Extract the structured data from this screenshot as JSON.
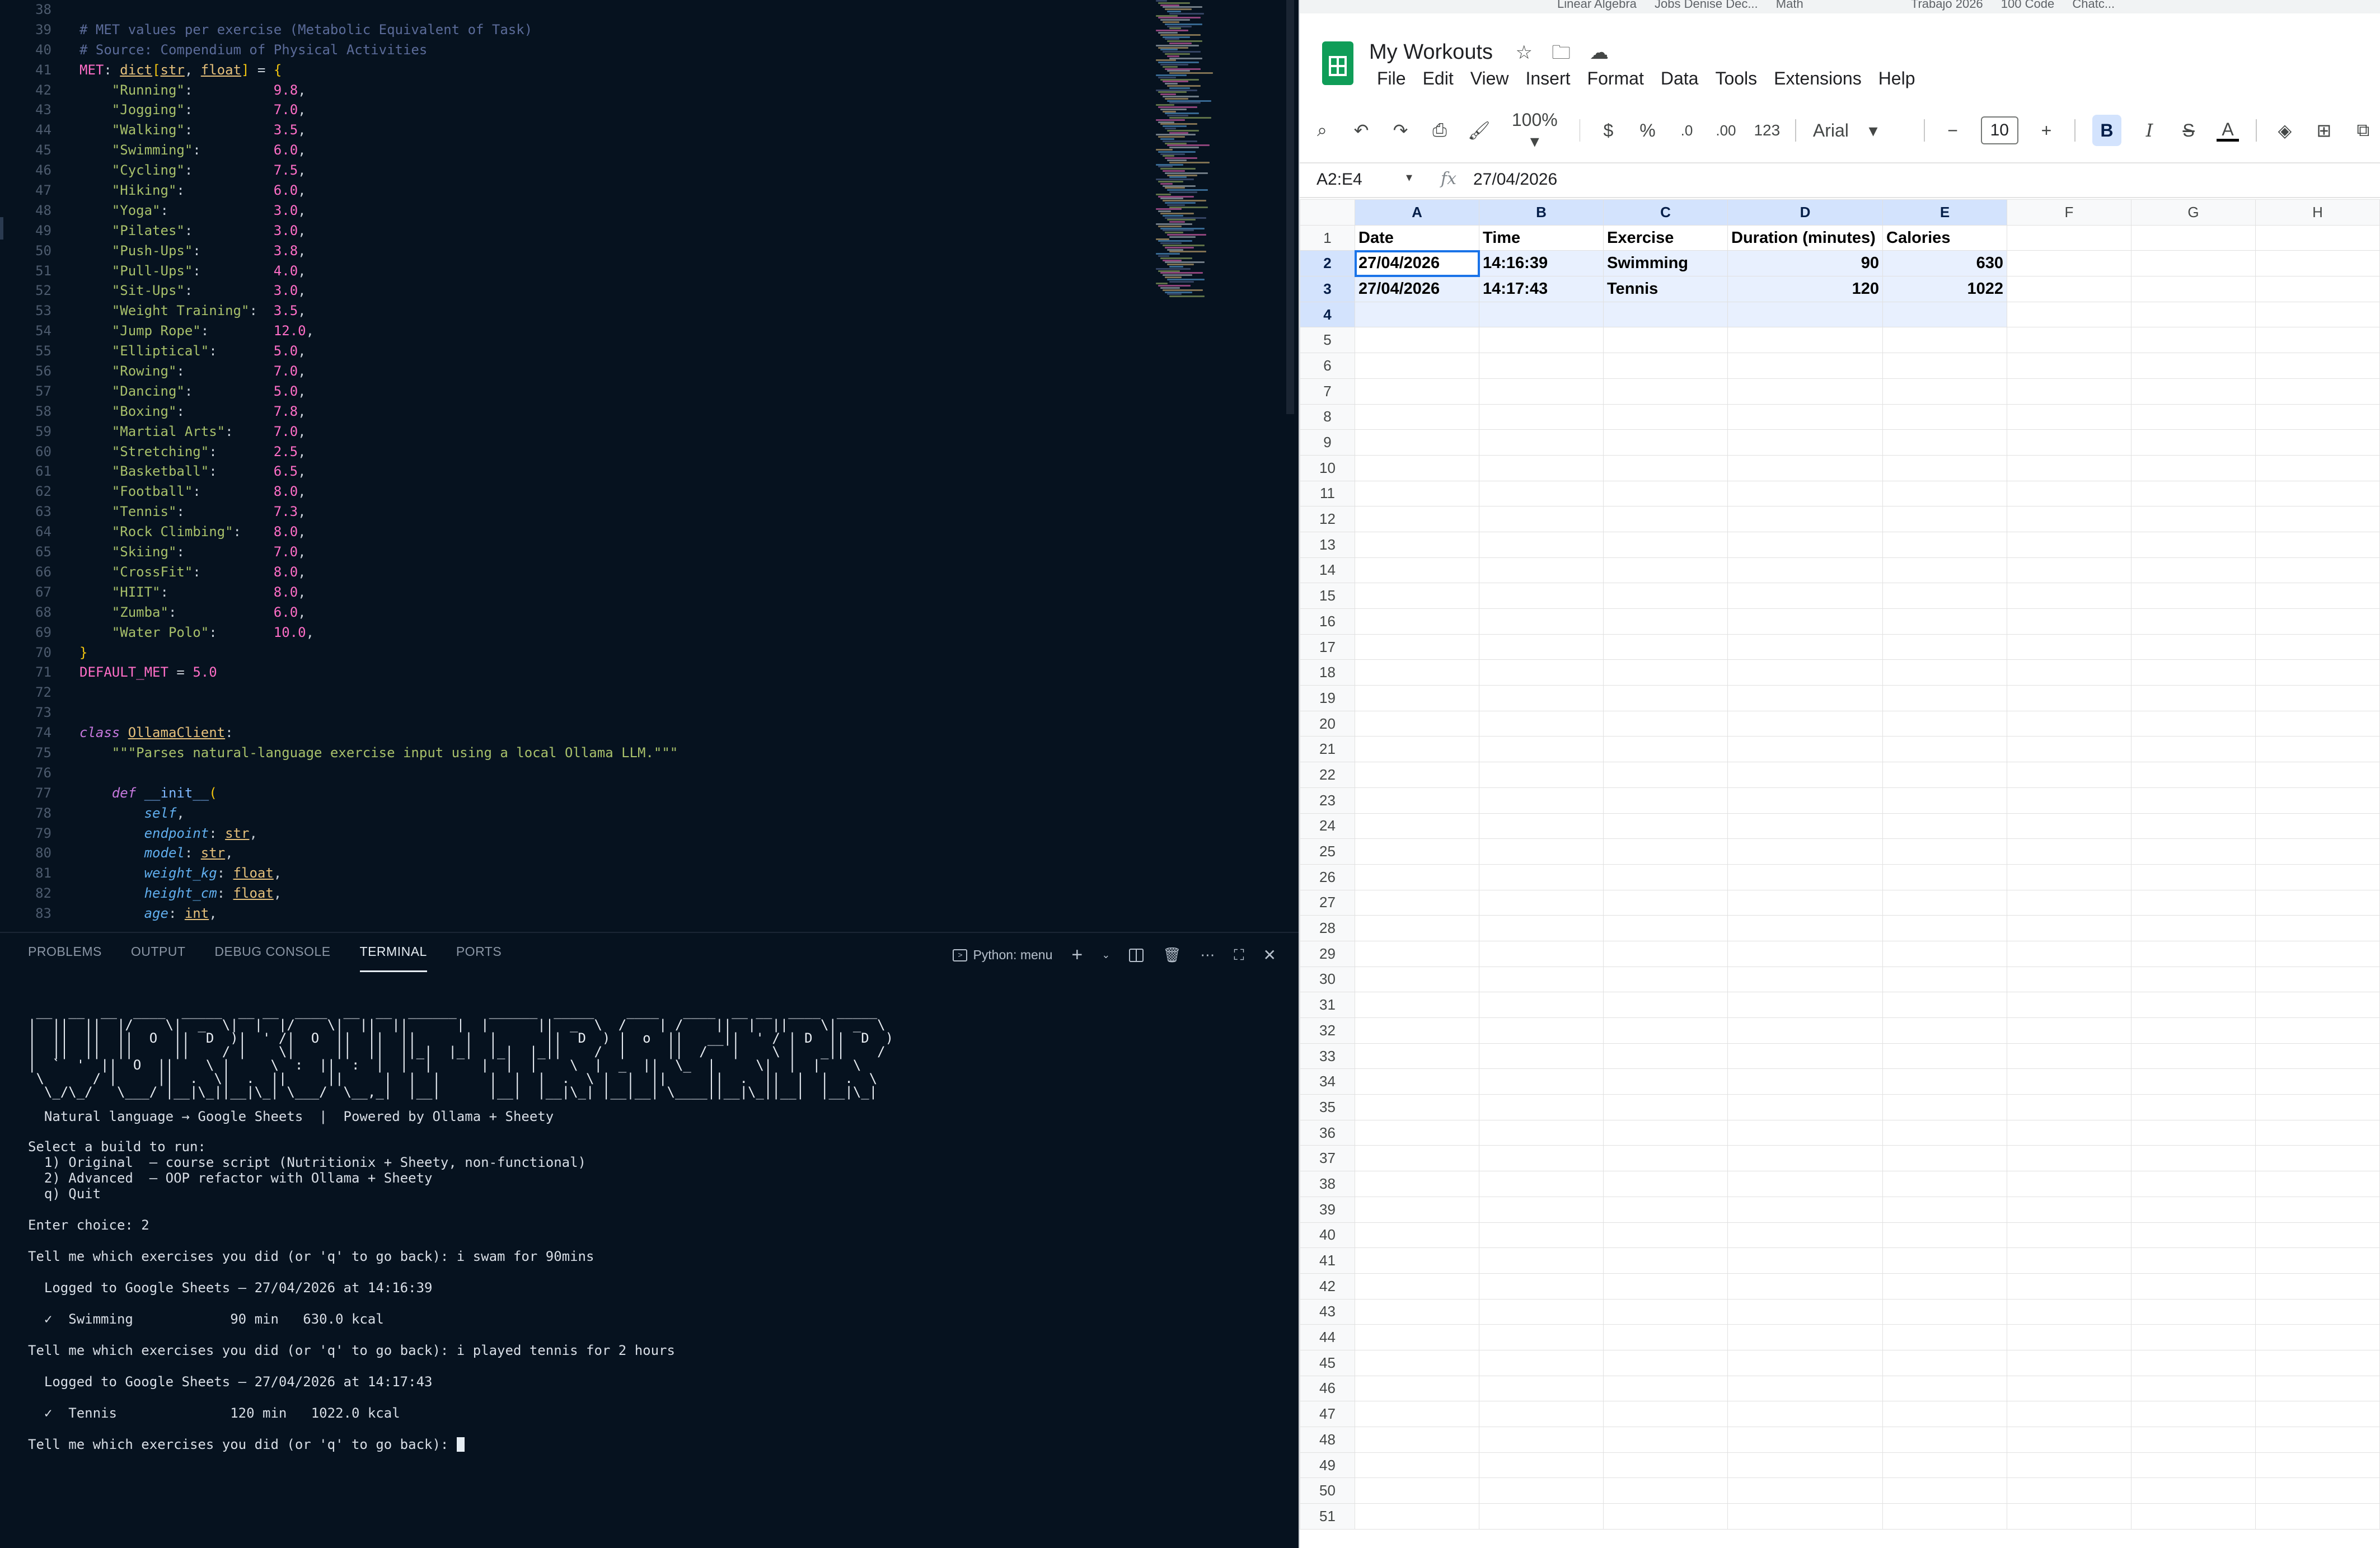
{
  "editor": {
    "lines": [
      {
        "n": "38",
        "parts": []
      },
      {
        "n": "39",
        "parts": [
          [
            "c-cm",
            "# MET values per exercise (Metabolic Equivalent of Task)"
          ]
        ]
      },
      {
        "n": "40",
        "parts": [
          [
            "c-cm",
            "# Source: Compendium of Physical Activities"
          ]
        ]
      },
      {
        "n": "41",
        "parts": [
          [
            "c-var",
            "MET"
          ],
          [
            "",
            ": "
          ],
          [
            "c-ty",
            "dict"
          ],
          [
            "c-brk",
            "["
          ],
          [
            "c-ty",
            "str"
          ],
          [
            "",
            ", "
          ],
          [
            "c-ty",
            "float"
          ],
          [
            "c-brk",
            "]"
          ],
          [
            "",
            " = "
          ],
          [
            "c-brk",
            "{"
          ]
        ]
      },
      {
        "n": "42",
        "parts": [
          [
            "",
            "    "
          ],
          [
            "c-str",
            "\"Running\""
          ],
          [
            "",
            ":          "
          ],
          [
            "c-num",
            "9.8"
          ],
          [
            "",
            ","
          ]
        ]
      },
      {
        "n": "43",
        "parts": [
          [
            "",
            "    "
          ],
          [
            "c-str",
            "\"Jogging\""
          ],
          [
            "",
            ":          "
          ],
          [
            "c-num",
            "7.0"
          ],
          [
            "",
            ","
          ]
        ]
      },
      {
        "n": "44",
        "parts": [
          [
            "",
            "    "
          ],
          [
            "c-str",
            "\"Walking\""
          ],
          [
            "",
            ":          "
          ],
          [
            "c-num",
            "3.5"
          ],
          [
            "",
            ","
          ]
        ]
      },
      {
        "n": "45",
        "parts": [
          [
            "",
            "    "
          ],
          [
            "c-str",
            "\"Swimming\""
          ],
          [
            "",
            ":         "
          ],
          [
            "c-num",
            "6.0"
          ],
          [
            "",
            ","
          ]
        ]
      },
      {
        "n": "46",
        "parts": [
          [
            "",
            "    "
          ],
          [
            "c-str",
            "\"Cycling\""
          ],
          [
            "",
            ":          "
          ],
          [
            "c-num",
            "7.5"
          ],
          [
            "",
            ","
          ]
        ]
      },
      {
        "n": "47",
        "parts": [
          [
            "",
            "    "
          ],
          [
            "c-str",
            "\"Hiking\""
          ],
          [
            "",
            ":           "
          ],
          [
            "c-num",
            "6.0"
          ],
          [
            "",
            ","
          ]
        ]
      },
      {
        "n": "48",
        "parts": [
          [
            "",
            "    "
          ],
          [
            "c-str",
            "\"Yoga\""
          ],
          [
            "",
            ":             "
          ],
          [
            "c-num",
            "3.0"
          ],
          [
            "",
            ","
          ]
        ]
      },
      {
        "n": "49",
        "parts": [
          [
            "",
            "    "
          ],
          [
            "c-str",
            "\"Pilates\""
          ],
          [
            "",
            ":          "
          ],
          [
            "c-num",
            "3.0"
          ],
          [
            "",
            ","
          ]
        ]
      },
      {
        "n": "50",
        "parts": [
          [
            "",
            "    "
          ],
          [
            "c-str",
            "\"Push-Ups\""
          ],
          [
            "",
            ":         "
          ],
          [
            "c-num",
            "3.8"
          ],
          [
            "",
            ","
          ]
        ]
      },
      {
        "n": "51",
        "parts": [
          [
            "",
            "    "
          ],
          [
            "c-str",
            "\"Pull-Ups\""
          ],
          [
            "",
            ":         "
          ],
          [
            "c-num",
            "4.0"
          ],
          [
            "",
            ","
          ]
        ]
      },
      {
        "n": "52",
        "parts": [
          [
            "",
            "    "
          ],
          [
            "c-str",
            "\"Sit-Ups\""
          ],
          [
            "",
            ":          "
          ],
          [
            "c-num",
            "3.0"
          ],
          [
            "",
            ","
          ]
        ]
      },
      {
        "n": "53",
        "parts": [
          [
            "",
            "    "
          ],
          [
            "c-str",
            "\"Weight Training\""
          ],
          [
            "",
            ":  "
          ],
          [
            "c-num",
            "3.5"
          ],
          [
            "",
            ","
          ]
        ]
      },
      {
        "n": "54",
        "parts": [
          [
            "",
            "    "
          ],
          [
            "c-str",
            "\"Jump Rope\""
          ],
          [
            "",
            ":        "
          ],
          [
            "c-num",
            "12.0"
          ],
          [
            "",
            ","
          ]
        ]
      },
      {
        "n": "55",
        "parts": [
          [
            "",
            "    "
          ],
          [
            "c-str",
            "\"Elliptical\""
          ],
          [
            "",
            ":       "
          ],
          [
            "c-num",
            "5.0"
          ],
          [
            "",
            ","
          ]
        ]
      },
      {
        "n": "56",
        "parts": [
          [
            "",
            "    "
          ],
          [
            "c-str",
            "\"Rowing\""
          ],
          [
            "",
            ":           "
          ],
          [
            "c-num",
            "7.0"
          ],
          [
            "",
            ","
          ]
        ]
      },
      {
        "n": "57",
        "parts": [
          [
            "",
            "    "
          ],
          [
            "c-str",
            "\"Dancing\""
          ],
          [
            "",
            ":          "
          ],
          [
            "c-num",
            "5.0"
          ],
          [
            "",
            ","
          ]
        ]
      },
      {
        "n": "58",
        "parts": [
          [
            "",
            "    "
          ],
          [
            "c-str",
            "\"Boxing\""
          ],
          [
            "",
            ":           "
          ],
          [
            "c-num",
            "7.8"
          ],
          [
            "",
            ","
          ]
        ]
      },
      {
        "n": "59",
        "parts": [
          [
            "",
            "    "
          ],
          [
            "c-str",
            "\"Martial Arts\""
          ],
          [
            "",
            ":     "
          ],
          [
            "c-num",
            "7.0"
          ],
          [
            "",
            ","
          ]
        ]
      },
      {
        "n": "60",
        "parts": [
          [
            "",
            "    "
          ],
          [
            "c-str",
            "\"Stretching\""
          ],
          [
            "",
            ":       "
          ],
          [
            "c-num",
            "2.5"
          ],
          [
            "",
            ","
          ]
        ]
      },
      {
        "n": "61",
        "parts": [
          [
            "",
            "    "
          ],
          [
            "c-str",
            "\"Basketball\""
          ],
          [
            "",
            ":       "
          ],
          [
            "c-num",
            "6.5"
          ],
          [
            "",
            ","
          ]
        ]
      },
      {
        "n": "62",
        "parts": [
          [
            "",
            "    "
          ],
          [
            "c-str",
            "\"Football\""
          ],
          [
            "",
            ":         "
          ],
          [
            "c-num",
            "8.0"
          ],
          [
            "",
            ","
          ]
        ]
      },
      {
        "n": "63",
        "parts": [
          [
            "",
            "    "
          ],
          [
            "c-str",
            "\"Tennis\""
          ],
          [
            "",
            ":           "
          ],
          [
            "c-num",
            "7.3"
          ],
          [
            "",
            ","
          ]
        ]
      },
      {
        "n": "64",
        "parts": [
          [
            "",
            "    "
          ],
          [
            "c-str",
            "\"Rock Climbing\""
          ],
          [
            "",
            ":    "
          ],
          [
            "c-num",
            "8.0"
          ],
          [
            "",
            ","
          ]
        ]
      },
      {
        "n": "65",
        "parts": [
          [
            "",
            "    "
          ],
          [
            "c-str",
            "\"Skiing\""
          ],
          [
            "",
            ":           "
          ],
          [
            "c-num",
            "7.0"
          ],
          [
            "",
            ","
          ]
        ]
      },
      {
        "n": "66",
        "parts": [
          [
            "",
            "    "
          ],
          [
            "c-str",
            "\"CrossFit\""
          ],
          [
            "",
            ":         "
          ],
          [
            "c-num",
            "8.0"
          ],
          [
            "",
            ","
          ]
        ]
      },
      {
        "n": "67",
        "parts": [
          [
            "",
            "    "
          ],
          [
            "c-str",
            "\"HIIT\""
          ],
          [
            "",
            ":             "
          ],
          [
            "c-num",
            "8.0"
          ],
          [
            "",
            ","
          ]
        ]
      },
      {
        "n": "68",
        "parts": [
          [
            "",
            "    "
          ],
          [
            "c-str",
            "\"Zumba\""
          ],
          [
            "",
            ":            "
          ],
          [
            "c-num",
            "6.0"
          ],
          [
            "",
            ","
          ]
        ]
      },
      {
        "n": "69",
        "parts": [
          [
            "",
            "    "
          ],
          [
            "c-str",
            "\"Water Polo\""
          ],
          [
            "",
            ":       "
          ],
          [
            "c-num",
            "10.0"
          ],
          [
            "",
            ","
          ]
        ]
      },
      {
        "n": "70",
        "parts": [
          [
            "c-brk",
            "}"
          ]
        ]
      },
      {
        "n": "71",
        "parts": [
          [
            "c-var",
            "DEFAULT_MET"
          ],
          [
            "",
            " = "
          ],
          [
            "c-num",
            "5.0"
          ]
        ]
      },
      {
        "n": "72",
        "parts": []
      },
      {
        "n": "73",
        "parts": []
      },
      {
        "n": "74",
        "parts": [
          [
            "c-kw",
            "class"
          ],
          [
            "",
            " "
          ],
          [
            "c-cls",
            "OllamaClient"
          ],
          [
            "",
            ":"
          ]
        ]
      },
      {
        "n": "75",
        "parts": [
          [
            "",
            "    "
          ],
          [
            "c-doc",
            "\"\"\"Parses natural-language exercise input using a local Ollama LLM.\"\"\""
          ]
        ]
      },
      {
        "n": "76",
        "parts": []
      },
      {
        "n": "77",
        "parts": [
          [
            "",
            "    "
          ],
          [
            "c-kw",
            "def"
          ],
          [
            "",
            " "
          ],
          [
            "c-fn",
            "__init__"
          ],
          [
            "c-brk",
            "("
          ]
        ]
      },
      {
        "n": "78",
        "parts": [
          [
            "",
            "        "
          ],
          [
            "c-par",
            "self"
          ],
          [
            "",
            ","
          ]
        ]
      },
      {
        "n": "79",
        "parts": [
          [
            "",
            "        "
          ],
          [
            "c-par",
            "endpoint"
          ],
          [
            "",
            ": "
          ],
          [
            "c-ty",
            "str"
          ],
          [
            "",
            ","
          ]
        ]
      },
      {
        "n": "80",
        "parts": [
          [
            "",
            "        "
          ],
          [
            "c-par",
            "model"
          ],
          [
            "",
            ": "
          ],
          [
            "c-ty",
            "str"
          ],
          [
            "",
            ","
          ]
        ]
      },
      {
        "n": "81",
        "parts": [
          [
            "",
            "        "
          ],
          [
            "c-par",
            "weight_kg"
          ],
          [
            "",
            ": "
          ],
          [
            "c-ty",
            "float"
          ],
          [
            "",
            ","
          ]
        ]
      },
      {
        "n": "82",
        "parts": [
          [
            "",
            "        "
          ],
          [
            "c-par",
            "height_cm"
          ],
          [
            "",
            ": "
          ],
          [
            "c-ty",
            "float"
          ],
          [
            "",
            ","
          ]
        ]
      },
      {
        "n": "83",
        "parts": [
          [
            "",
            "        "
          ],
          [
            "c-par",
            "age"
          ],
          [
            "",
            ": "
          ],
          [
            "c-ty",
            "int"
          ],
          [
            "",
            ","
          ]
        ]
      }
    ]
  },
  "panel": {
    "tabs": [
      "PROBLEMS",
      "OUTPUT",
      "DEBUG CONSOLE",
      "TERMINAL",
      "PORTS"
    ],
    "active_tab": "TERMINAL",
    "shell_label": "Python: menu"
  },
  "terminal": {
    "banner_lines": [
      " __  __  __  ____  _____  __ __  ____  __  __  ______    ______  _____    ____   ____  __ __  ____  _____ ",
      "|  ||  ||  |/    \\|  _  \\|  |  |/    \\|  ||  ||      |  |      ||  _  \\  /    | /    ||  |  ||    \\|  _  \\",
      "|  ||  ||  ||  O  ||  D  )|  ' /|  O  ||  ||  ||      |  |      ||  D  ) |  o  ||   __||  ' / | D  ||  D  )",
      "|  ||  ||  ||     ||    / |    \\|     ||  ||  ||_|  |_|  |_|  |_||    /  |     ||  /   |    \\ |   _||    / ",
      "|  `  '  ||  O  ||    \\ |     \\  :  ||  :  |  |  |      |  |  |    \\  |  _  ||  \\_  |     \\|  |  |    \\ ",
      " \\      / |     ||  .  \\|  .  ||     ||     |  |  |      |  |  |  .  \\ |  |  ||     ||  .  ||  |  |  .  \\",
      "  \\_/\\_/   \\___/ |__|\\_||__|\\_| \\___/  \\__,_|  |__|      |__|  |__|\\_| |__|__| \\____||__|\\_||__|  |__|\\_|"
    ],
    "tagline": "  Natural language → Google Sheets  |  Powered by Ollama + Sheety",
    "menu_prompt": "Select a build to run:",
    "menu_options": [
      "  1) Original  — course script (Nutritionix + Sheety, non-functional)",
      "  2) Advanced  — OOP refactor with Ollama + Sheety",
      "  q) Quit"
    ],
    "choice_line": "Enter choice: 2",
    "entries": [
      {
        "prompt": "Tell me which exercises you did (or 'q' to go back): i swam for 90mins",
        "logged": "  Logged to Google Sheets — 27/04/2026 at 14:16:39",
        "result": "  ✓  Swimming            90 min   630.0 kcal"
      },
      {
        "prompt": "Tell me which exercises you did (or 'q' to go back): i played tennis for 2 hours",
        "logged": "  Logged to Google Sheets — 27/04/2026 at 14:17:43",
        "result": "  ✓  Tennis              120 min   1022.0 kcal"
      }
    ],
    "final_prompt": "Tell me which exercises you did (or 'q' to go back): "
  },
  "sheets": {
    "bookmarks": [
      "Linear Algebra",
      "Jobs Denise Dec...",
      "Math",
      "Trabajo 2026",
      "100 Code",
      "Chatc..."
    ],
    "title": "My Workouts",
    "menus": [
      "File",
      "Edit",
      "View",
      "Insert",
      "Format",
      "Data",
      "Tools",
      "Extensions",
      "Help"
    ],
    "toolbar": {
      "zoom": "100%",
      "currency": "$",
      "percent": "%",
      "dec_minus": ".0",
      "dec_plus": ".00",
      "format_123": "123",
      "font": "Arial",
      "font_size": "10",
      "bold": "B",
      "italic": "I",
      "text_color": "A"
    },
    "name_box": "A2:E4",
    "formula_value": "27/04/2026",
    "columns": [
      "A",
      "B",
      "C",
      "D",
      "E",
      "F",
      "G",
      "H"
    ],
    "header_row": [
      "Date",
      "Time",
      "Exercise",
      "Duration (minutes)",
      "Calories"
    ],
    "rows": [
      [
        "27/04/2026",
        "14:16:39",
        "Swimming",
        "90",
        "630"
      ],
      [
        "27/04/2026",
        "14:17:43",
        "Tennis",
        "120",
        "1022"
      ]
    ],
    "visible_row_count": 51,
    "colors": {
      "accent": "#1a73e8",
      "brand": "#0f9d58",
      "selection": "#d3e3fd"
    }
  }
}
